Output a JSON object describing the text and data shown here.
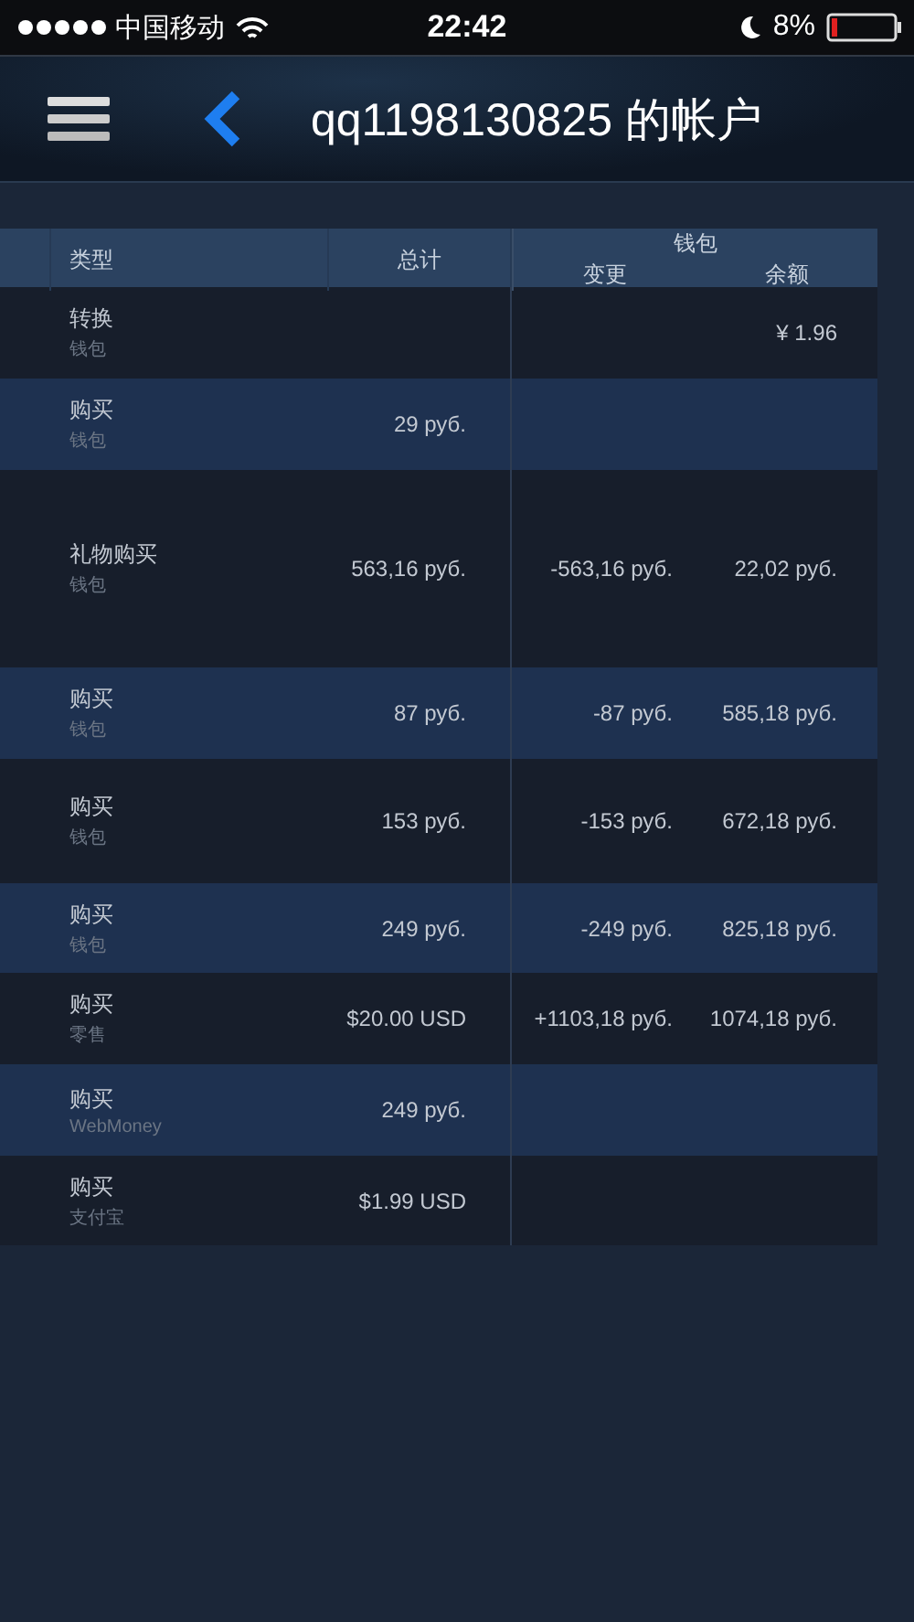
{
  "status_bar": {
    "carrier": "中国移动",
    "time": "22:42",
    "battery": "8%"
  },
  "nav_bar": {
    "title": "qq1198130825 的帐户"
  },
  "table": {
    "columns": {
      "type": "类型",
      "total": "总计",
      "wallet": "钱包",
      "change": "变更",
      "balance": "余额"
    },
    "rows": [
      {
        "type": "转换",
        "method": "钱包",
        "total": "",
        "change": "",
        "balance": "¥ 1.96"
      },
      {
        "type": "购买",
        "method": "钱包",
        "total": "29 руб.",
        "change": "",
        "balance": ""
      },
      {
        "type": "礼物购买",
        "method": "钱包",
        "total": "563,16 руб.",
        "change": "-563,16 руб.",
        "balance": "22,02 руб."
      },
      {
        "type": "购买",
        "method": "钱包",
        "total": "87 руб.",
        "change": "-87 руб.",
        "balance": "585,18 руб."
      },
      {
        "type": "购买",
        "method": "钱包",
        "total": "153 руб.",
        "change": "-153 руб.",
        "balance": "672,18 руб."
      },
      {
        "type": "购买",
        "method": "钱包",
        "total": "249 руб.",
        "change": "-249 руб.",
        "balance": "825,18 руб."
      },
      {
        "type": "购买",
        "method": "零售",
        "total": "$20.00 USD",
        "change": "+1103,18 руб.",
        "balance": "1074,18 руб."
      },
      {
        "type": "购买",
        "method": "WebMoney",
        "total": "249 руб.",
        "change": "",
        "balance": ""
      },
      {
        "type": "购买",
        "method": "支付宝",
        "total": "$1.99 USD",
        "change": "",
        "balance": ""
      }
    ]
  }
}
